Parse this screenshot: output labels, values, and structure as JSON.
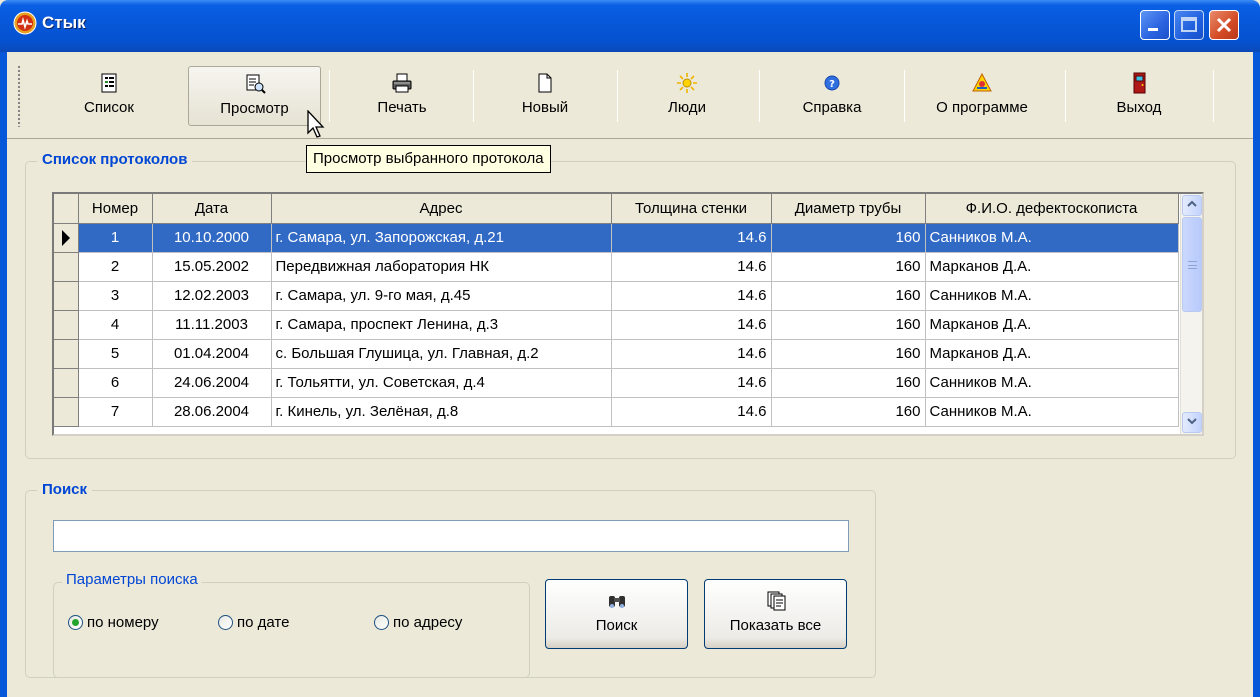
{
  "window": {
    "title": "Стык"
  },
  "toolbar": {
    "items": [
      {
        "label": "Список",
        "icon": "list-icon"
      },
      {
        "label": "Просмотр",
        "icon": "view-icon"
      },
      {
        "label": "Печать",
        "icon": "printer-icon"
      },
      {
        "label": "Новый",
        "icon": "new-document-icon"
      },
      {
        "label": "Люди",
        "icon": "people-sun-icon"
      },
      {
        "label": "Справка",
        "icon": "help-icon"
      },
      {
        "label": "О программе",
        "icon": "about-icon"
      },
      {
        "label": "Выход",
        "icon": "exit-door-icon"
      }
    ]
  },
  "tooltip": {
    "text": "Просмотр выбранного протокола"
  },
  "protocols": {
    "title": "Список протоколов",
    "columns": [
      "Номер",
      "Дата",
      "Адрес",
      "Толщина стенки",
      "Диаметр трубы",
      "Ф.И.О. дефектоскописта"
    ],
    "selected_index": 0,
    "rows": [
      [
        "1",
        "10.10.2000",
        "г. Самара, ул. Запорожская, д.21",
        "14.6",
        "160",
        "Санников М.А."
      ],
      [
        "2",
        "15.05.2002",
        "Передвижная лаборатория НК",
        "14.6",
        "160",
        "Марканов Д.А."
      ],
      [
        "3",
        "12.02.2003",
        "г. Самара, ул. 9-го мая,  д.45",
        "14.6",
        "160",
        "Санников М.А."
      ],
      [
        "4",
        "11.11.2003",
        "г. Самара, проспект Ленина, д.3",
        "14.6",
        "160",
        "Марканов Д.А."
      ],
      [
        "5",
        "01.04.2004",
        "с. Большая Глушица, ул. Главная, д.2",
        "14.6",
        "160",
        "Марканов Д.А."
      ],
      [
        "6",
        "24.06.2004",
        "г. Тольятти, ул. Советская, д.4",
        "14.6",
        "160",
        "Санников М.А."
      ],
      [
        "7",
        "28.06.2004",
        "г. Кинель, ул. Зелёная, д.8",
        "14.6",
        "160",
        "Санников М.А."
      ]
    ]
  },
  "search": {
    "title": "Поиск",
    "value": "",
    "params_title": "Параметры поиска",
    "options": [
      {
        "label": "по номеру",
        "checked": true
      },
      {
        "label": "по дате",
        "checked": false
      },
      {
        "label": "по адресу",
        "checked": false
      }
    ],
    "search_button": "Поиск",
    "show_all_button": "Показать все"
  },
  "colors": {
    "titlebar": "#0757d9",
    "selection": "#316ac5",
    "group_title": "#0046d5",
    "tooltip_bg": "#ffffe1"
  }
}
